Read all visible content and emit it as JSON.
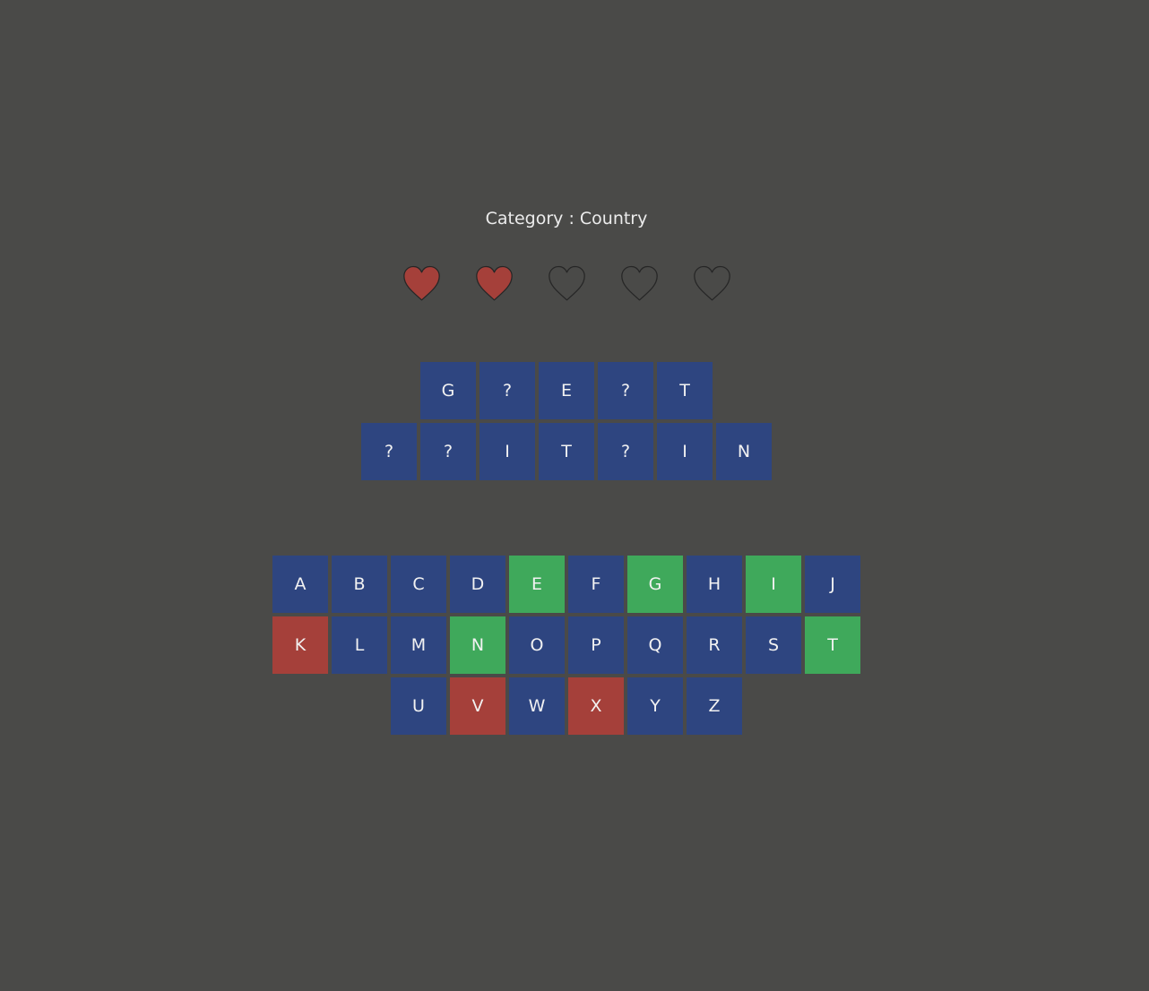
{
  "category": {
    "text": "Category : Country"
  },
  "lives": {
    "total": 5,
    "remaining": 2,
    "filled_color": "#a5403a",
    "empty_color": "#4a4a48",
    "icon": "heart-icon"
  },
  "word": {
    "rows": [
      [
        "G",
        "?",
        "E",
        "?",
        "T"
      ],
      [
        "?",
        "?",
        "I",
        "T",
        "?",
        "I",
        "N"
      ]
    ]
  },
  "keyboard": {
    "colors": {
      "unused": "#2e4580",
      "correct": "#3fa95b",
      "wrong": "#a5403a"
    },
    "rows": [
      [
        {
          "letter": "A",
          "state": "unused"
        },
        {
          "letter": "B",
          "state": "unused"
        },
        {
          "letter": "C",
          "state": "unused"
        },
        {
          "letter": "D",
          "state": "unused"
        },
        {
          "letter": "E",
          "state": "correct"
        },
        {
          "letter": "F",
          "state": "unused"
        },
        {
          "letter": "G",
          "state": "correct"
        },
        {
          "letter": "H",
          "state": "unused"
        },
        {
          "letter": "I",
          "state": "correct"
        },
        {
          "letter": "J",
          "state": "unused"
        }
      ],
      [
        {
          "letter": "K",
          "state": "wrong"
        },
        {
          "letter": "L",
          "state": "unused"
        },
        {
          "letter": "M",
          "state": "unused"
        },
        {
          "letter": "N",
          "state": "correct"
        },
        {
          "letter": "O",
          "state": "unused"
        },
        {
          "letter": "P",
          "state": "unused"
        },
        {
          "letter": "Q",
          "state": "unused"
        },
        {
          "letter": "R",
          "state": "unused"
        },
        {
          "letter": "S",
          "state": "unused"
        },
        {
          "letter": "T",
          "state": "correct"
        }
      ],
      [
        {
          "letter": "U",
          "state": "unused"
        },
        {
          "letter": "V",
          "state": "wrong"
        },
        {
          "letter": "W",
          "state": "unused"
        },
        {
          "letter": "X",
          "state": "wrong"
        },
        {
          "letter": "Y",
          "state": "unused"
        },
        {
          "letter": "Z",
          "state": "unused"
        }
      ]
    ]
  }
}
